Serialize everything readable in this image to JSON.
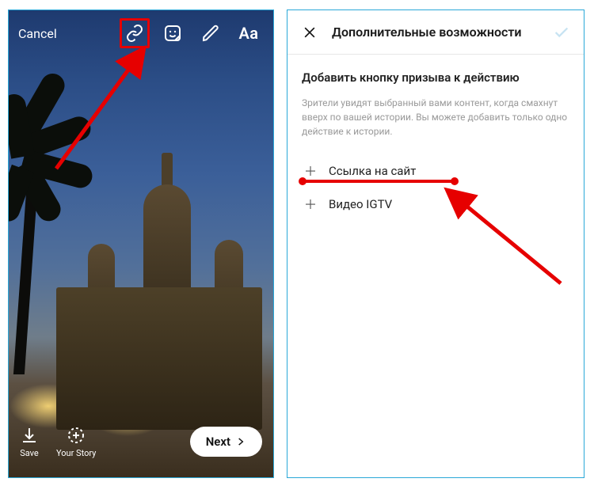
{
  "left": {
    "cancel_label": "Cancel",
    "tool_aa": "Aa",
    "save_label": "Save",
    "your_story_label": "Your Story",
    "next_label": "Next"
  },
  "right": {
    "title": "Дополнительные возможности",
    "cta_heading": "Добавить кнопку призыва к действию",
    "cta_description": "Зрители увидят выбранный вами контент, когда смахнут вверх по вашей истории. Вы можете добавить только одно действие к истории.",
    "option_link": "Ссылка на сайт",
    "option_igtv": "Видео IGTV"
  }
}
